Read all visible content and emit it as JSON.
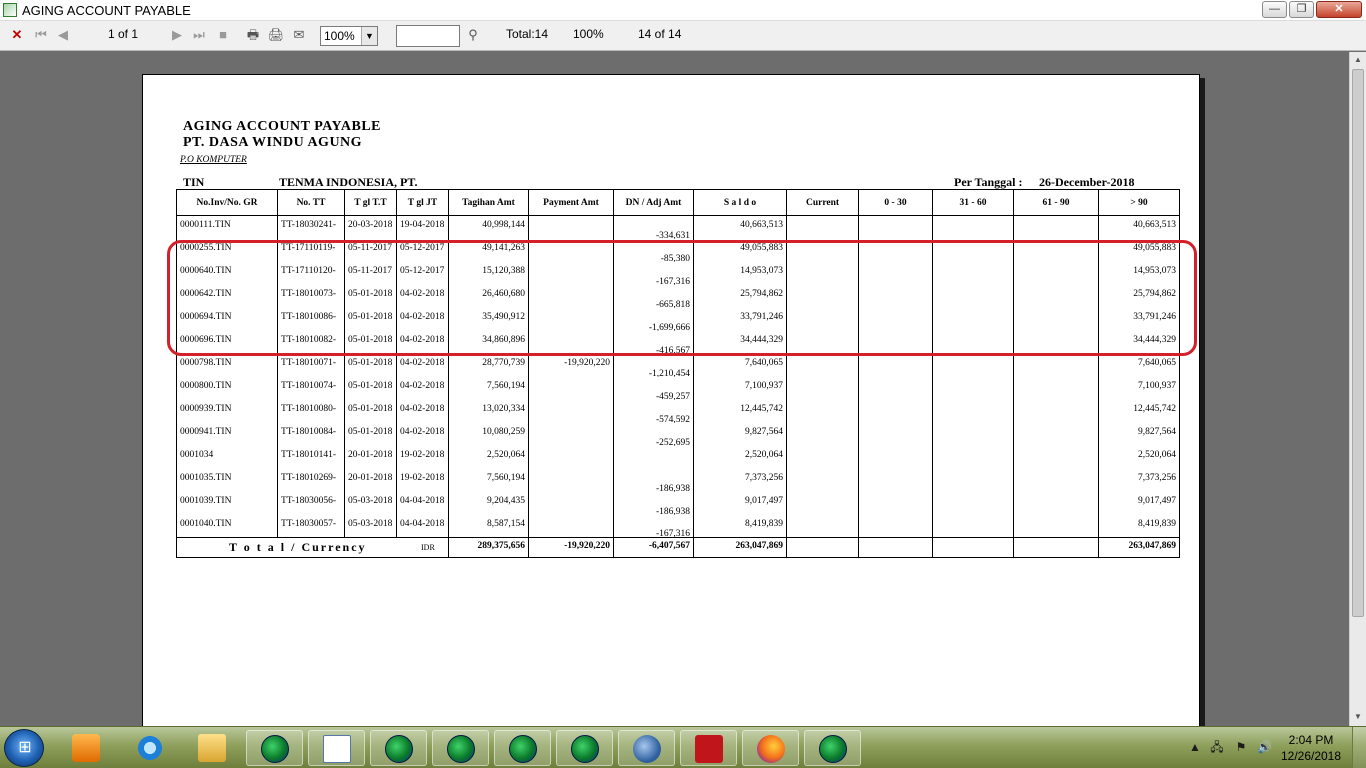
{
  "window": {
    "title": "AGING ACCOUNT PAYABLE",
    "minimize": "—",
    "maximize": "❐",
    "close": "✕"
  },
  "toolbar": {
    "page_indicator": "1 of 1",
    "zoom": "100%",
    "total": "Total:14",
    "percent": "100%",
    "records": "14 of 14"
  },
  "report": {
    "title": "AGING ACCOUNT PAYABLE",
    "company": "PT. DASA WINDU AGUNG",
    "subtitle": "P.O KOMPUTER",
    "supplier_code": "TIN",
    "supplier_name": "TENMA INDONESIA, PT.",
    "date_label": "Per Tanggal :",
    "date_value": "26-December-2018",
    "columns": [
      "No.Inv/No. GR",
      "No. TT",
      "T gl T.T",
      "T gl JT",
      "Tagihan Amt",
      "Payment Amt",
      "DN / Adj Amt",
      "S a l d o",
      "Current",
      "0 - 30",
      "31 - 60",
      "61 - 90",
      "> 90"
    ],
    "rows": [
      {
        "inv": "0000111.TIN",
        "tt": "TT-18030241-",
        "tgl_tt": "20-03-2018",
        "tgl_jt": "19-04-2018",
        "tagihan": "40,998,144",
        "payment": "",
        "dn": "-334,631",
        "saldo": "40,663,513",
        "current": "",
        "d30": "",
        "d60": "",
        "d90": "",
        "over90": "40,663,513"
      },
      {
        "inv": "0000255.TIN",
        "tt": "TT-17110119-",
        "tgl_tt": "05-11-2017",
        "tgl_jt": "05-12-2017",
        "tagihan": "49,141,263",
        "payment": "",
        "dn": "-85,380",
        "saldo": "49,055,883",
        "current": "",
        "d30": "",
        "d60": "",
        "d90": "",
        "over90": "49,055,883"
      },
      {
        "inv": "0000640.TIN",
        "tt": "TT-17110120-",
        "tgl_tt": "05-11-2017",
        "tgl_jt": "05-12-2017",
        "tagihan": "15,120,388",
        "payment": "",
        "dn": "-167,316",
        "saldo": "14,953,073",
        "current": "",
        "d30": "",
        "d60": "",
        "d90": "",
        "over90": "14,953,073"
      },
      {
        "inv": "0000642.TIN",
        "tt": "TT-18010073-",
        "tgl_tt": "05-01-2018",
        "tgl_jt": "04-02-2018",
        "tagihan": "26,460,680",
        "payment": "",
        "dn": "-665,818",
        "saldo": "25,794,862",
        "current": "",
        "d30": "",
        "d60": "",
        "d90": "",
        "over90": "25,794,862"
      },
      {
        "inv": "0000694.TIN",
        "tt": "TT-18010086-",
        "tgl_tt": "05-01-2018",
        "tgl_jt": "04-02-2018",
        "tagihan": "35,490,912",
        "payment": "",
        "dn": "-1,699,666",
        "saldo": "33,791,246",
        "current": "",
        "d30": "",
        "d60": "",
        "d90": "",
        "over90": "33,791,246"
      },
      {
        "inv": "0000696.TIN",
        "tt": "TT-18010082-",
        "tgl_tt": "05-01-2018",
        "tgl_jt": "04-02-2018",
        "tagihan": "34,860,896",
        "payment": "",
        "dn": "-416,567",
        "saldo": "34,444,329",
        "current": "",
        "d30": "",
        "d60": "",
        "d90": "",
        "over90": "34,444,329"
      },
      {
        "inv": "0000798.TIN",
        "tt": "TT-18010071-",
        "tgl_tt": "05-01-2018",
        "tgl_jt": "04-02-2018",
        "tagihan": "28,770,739",
        "payment": "-19,920,220",
        "dn": "-1,210,454",
        "saldo": "7,640,065",
        "current": "",
        "d30": "",
        "d60": "",
        "d90": "",
        "over90": "7,640,065"
      },
      {
        "inv": "0000800.TIN",
        "tt": "TT-18010074-",
        "tgl_tt": "05-01-2018",
        "tgl_jt": "04-02-2018",
        "tagihan": "7,560,194",
        "payment": "",
        "dn": "-459,257",
        "saldo": "7,100,937",
        "current": "",
        "d30": "",
        "d60": "",
        "d90": "",
        "over90": "7,100,937"
      },
      {
        "inv": "0000939.TIN",
        "tt": "TT-18010080-",
        "tgl_tt": "05-01-2018",
        "tgl_jt": "04-02-2018",
        "tagihan": "13,020,334",
        "payment": "",
        "dn": "-574,592",
        "saldo": "12,445,742",
        "current": "",
        "d30": "",
        "d60": "",
        "d90": "",
        "over90": "12,445,742"
      },
      {
        "inv": "0000941.TIN",
        "tt": "TT-18010084-",
        "tgl_tt": "05-01-2018",
        "tgl_jt": "04-02-2018",
        "tagihan": "10,080,259",
        "payment": "",
        "dn": "-252,695",
        "saldo": "9,827,564",
        "current": "",
        "d30": "",
        "d60": "",
        "d90": "",
        "over90": "9,827,564"
      },
      {
        "inv": "0001034",
        "tt": "TT-18010141-",
        "tgl_tt": "20-01-2018",
        "tgl_jt": "19-02-2018",
        "tagihan": "2,520,064",
        "payment": "",
        "dn": "",
        "saldo": "2,520,064",
        "current": "",
        "d30": "",
        "d60": "",
        "d90": "",
        "over90": "2,520,064"
      },
      {
        "inv": "0001035.TIN",
        "tt": "TT-18010269-",
        "tgl_tt": "20-01-2018",
        "tgl_jt": "19-02-2018",
        "tagihan": "7,560,194",
        "payment": "",
        "dn": "-186,938",
        "saldo": "7,373,256",
        "current": "",
        "d30": "",
        "d60": "",
        "d90": "",
        "over90": "7,373,256"
      },
      {
        "inv": "0001039.TIN",
        "tt": "TT-18030056-",
        "tgl_tt": "05-03-2018",
        "tgl_jt": "04-04-2018",
        "tagihan": "9,204,435",
        "payment": "",
        "dn": "-186,938",
        "saldo": "9,017,497",
        "current": "",
        "d30": "",
        "d60": "",
        "d90": "",
        "over90": "9,017,497"
      },
      {
        "inv": "0001040.TIN",
        "tt": "TT-18030057-",
        "tgl_tt": "05-03-2018",
        "tgl_jt": "04-04-2018",
        "tagihan": "8,587,154",
        "payment": "",
        "dn": "-167,316",
        "saldo": "8,419,839",
        "current": "",
        "d30": "",
        "d60": "",
        "d90": "",
        "over90": "8,419,839"
      }
    ],
    "total": {
      "label": "T o t a l / Currency",
      "currency": "IDR",
      "tagihan": "289,375,656",
      "payment": "-19,920,220",
      "dn": "-6,407,567",
      "saldo": "263,047,869",
      "current": "",
      "d30": "",
      "d60": "",
      "d90": "",
      "over90": "263,047,869"
    }
  },
  "taskbar": {
    "clock_time": "2:04 PM",
    "clock_date": "12/26/2018"
  },
  "colors": {
    "highlight": "#d4202a",
    "viewer_bg": "#6d6d6d"
  }
}
